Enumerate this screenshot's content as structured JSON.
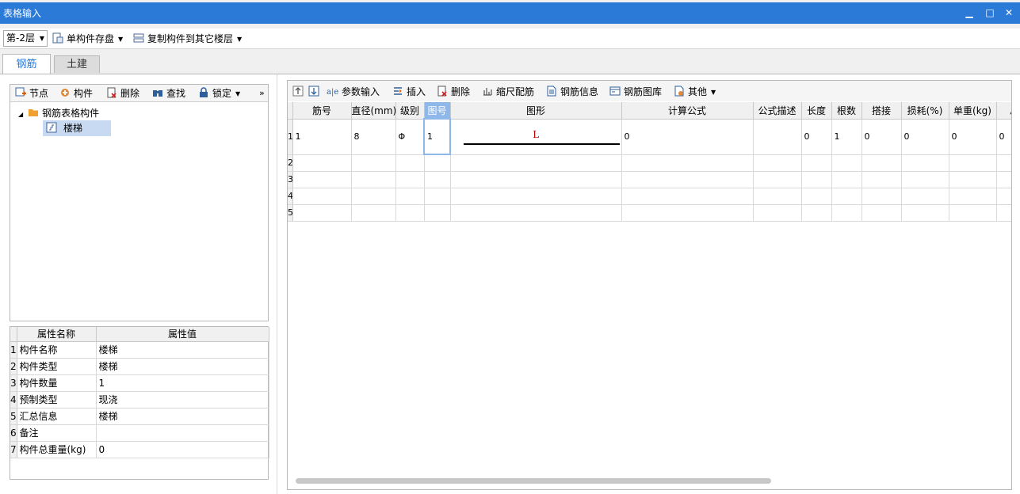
{
  "window": {
    "title": "表格输入",
    "minimize_glyph": "▁",
    "maximize_glyph": "□",
    "close_glyph": "✕"
  },
  "toolbar": {
    "floor_value": "第-2层",
    "save_component_label": "单构件存盘",
    "copy_to_floor_label": "复制构件到其它楼层"
  },
  "tabs": [
    {
      "label": "钢筋"
    },
    {
      "label": "土建"
    }
  ],
  "left_toolbar": {
    "node_label": "节点",
    "component_label": "构件",
    "delete_label": "删除",
    "find_label": "查找",
    "lock_label": "锁定",
    "more_glyph": "»"
  },
  "tree": {
    "root_label": "钢筋表格构件",
    "child_label": "楼梯"
  },
  "properties": {
    "headers": [
      "属性名称",
      "属性值"
    ],
    "rows": [
      {
        "index": "1",
        "name": "构件名称",
        "value": "楼梯"
      },
      {
        "index": "2",
        "name": "构件类型",
        "value": "楼梯"
      },
      {
        "index": "3",
        "name": "构件数量",
        "value": "1"
      },
      {
        "index": "4",
        "name": "预制类型",
        "value": "现浇"
      },
      {
        "index": "5",
        "name": "汇总信息",
        "value": "楼梯"
      },
      {
        "index": "6",
        "name": "备注",
        "value": ""
      },
      {
        "index": "7",
        "name": "构件总重量(kg)",
        "value": "0"
      }
    ]
  },
  "right_toolbar": {
    "param_input_label": "参数输入",
    "insert_label": "插入",
    "delete_label": "删除",
    "scale_rebar_label": "缩尺配筋",
    "rebar_info_label": "钢筋信息",
    "rebar_library_label": "钢筋图库",
    "other_label": "其他"
  },
  "grid": {
    "headers": [
      "筋号",
      "直径(mm)",
      "级别",
      "图号",
      "图形",
      "计算公式",
      "公式描述",
      "长度",
      "根数",
      "搭接",
      "损耗(%)",
      "单重(kg)",
      "总"
    ],
    "rows": [
      {
        "index": "1",
        "bar_no": "1",
        "diameter": "8",
        "grade": "Φ",
        "figure_no": "1",
        "shape_label": "L",
        "formula": "0",
        "desc": "",
        "length": "0",
        "count": "1",
        "lap": "0",
        "loss": "0",
        "unit_weight": "0",
        "total": "0"
      },
      {
        "index": "2"
      },
      {
        "index": "3"
      },
      {
        "index": "4"
      },
      {
        "index": "5"
      }
    ]
  },
  "colors": {
    "titlebar": "#2b7ad8",
    "selection": "#c7daf1",
    "header_selected": "#8fb8ea",
    "shape_label": "#c00000"
  }
}
